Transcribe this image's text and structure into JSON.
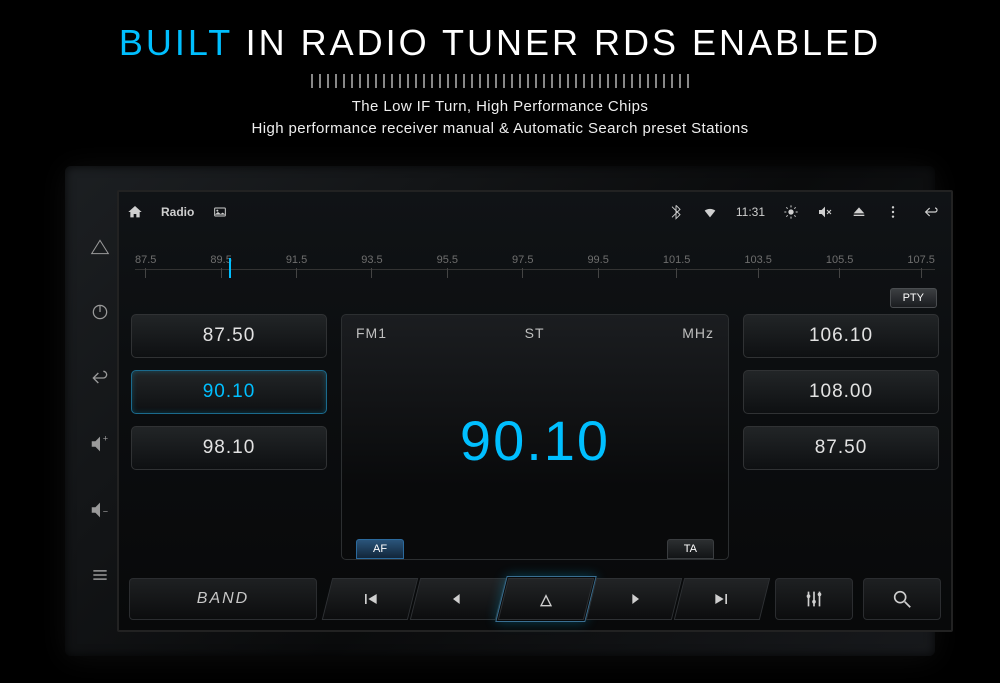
{
  "hero": {
    "title_accent": "BUILT",
    "title_rest": " IN RADIO TUNER RDS ENABLED",
    "sub1": "The Low IF Turn, High Performance Chips",
    "sub2": "High performance receiver manual & Automatic Search preset Stations"
  },
  "statusbar": {
    "app_label": "Radio",
    "time": "11:31"
  },
  "dial": {
    "labels": [
      "87.5",
      "89.5",
      "91.5",
      "93.5",
      "95.5",
      "97.5",
      "99.5",
      "101.5",
      "103.5",
      "105.5",
      "107.5"
    ],
    "pty_label": "PTY"
  },
  "tuner": {
    "band": "FM1",
    "st": "ST",
    "unit": "MHz",
    "frequency": "90.10",
    "af": "AF",
    "ta": "TA"
  },
  "presets_left": [
    {
      "freq": "87.50",
      "active": false
    },
    {
      "freq": "90.10",
      "active": true
    },
    {
      "freq": "98.10",
      "active": false
    }
  ],
  "presets_right": [
    {
      "freq": "106.10",
      "active": false
    },
    {
      "freq": "108.00",
      "active": false
    },
    {
      "freq": "87.50",
      "active": false
    }
  ],
  "controls": {
    "band_label": "BAND"
  }
}
